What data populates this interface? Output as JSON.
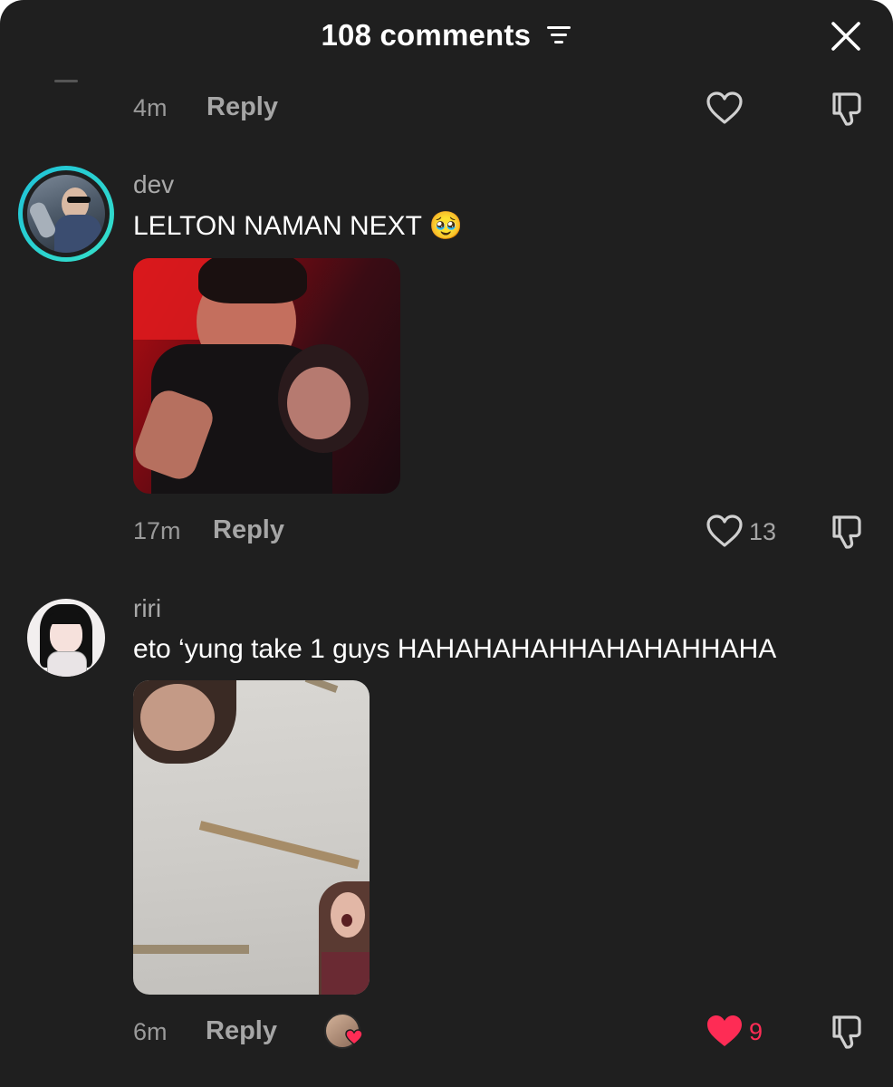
{
  "header": {
    "title": "108 comments",
    "filter_icon": "filter-lines-icon",
    "close_icon": "close-x-icon"
  },
  "colors": {
    "background": "#1f1f1f",
    "text_primary": "#ffffff",
    "text_secondary": "#a6a6a6",
    "liked": "#fe2c55",
    "avatar_ring": "#1fc2d8"
  },
  "comments": [
    {
      "time": "4m",
      "reply_label": "Reply",
      "like_count": "",
      "liked": false
    },
    {
      "username": "dev",
      "text": "LELTON NAMAN NEXT",
      "emoji": "🥹",
      "time": "17m",
      "reply_label": "Reply",
      "like_count": "13",
      "liked": false
    },
    {
      "username": "riri",
      "text": "eto ‘yung take 1 guys HAHAHAHAHHAHAHAHHAHA",
      "time": "6m",
      "reply_label": "Reply",
      "like_count": "9",
      "liked": true,
      "creator_liked_icon": "creator-liked-avatar-icon"
    }
  ]
}
